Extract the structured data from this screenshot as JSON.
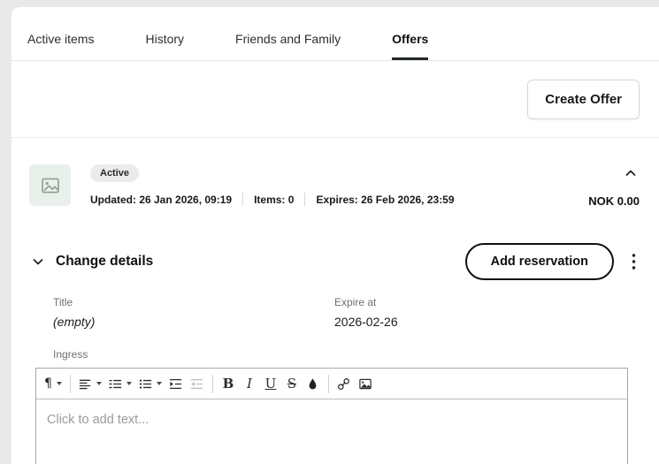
{
  "tabs": {
    "items": [
      {
        "label": "Active items"
      },
      {
        "label": "History"
      },
      {
        "label": "Friends and Family"
      },
      {
        "label": "Offers"
      }
    ]
  },
  "actions": {
    "create_offer": "Create Offer"
  },
  "offer": {
    "status": "Active",
    "updated": "Updated: 26 Jan 2026, 09:19",
    "items": "Items: 0",
    "expires": "Expires: 26 Feb 2026, 23:59",
    "amount": "NOK 0.00"
  },
  "details": {
    "heading": "Change details",
    "add_reservation": "Add reservation",
    "title_label": "Title",
    "title_value": "(empty)",
    "expire_label": "Expire at",
    "expire_value": "2026-02-26",
    "ingress_label": "Ingress"
  },
  "editor": {
    "paragraph_glyph": "¶",
    "bold_glyph": "B",
    "italic_glyph": "I",
    "underline_glyph": "U",
    "strikethrough_glyph": "S",
    "placeholder": "Click to add text..."
  },
  "colors": {
    "accent": "#1a1a1a",
    "badge_bg": "#ebebeb",
    "thumb_bg": "#e9f0eb",
    "tab_underline": "#23282b"
  }
}
